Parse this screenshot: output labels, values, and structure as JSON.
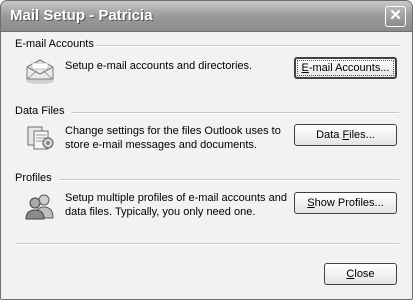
{
  "window": {
    "title": "Mail Setup - Patricia",
    "close_glyph": "✕"
  },
  "sections": [
    {
      "title": "E-mail Accounts",
      "description": "Setup e-mail accounts and directories.",
      "button": {
        "ul": "E",
        "rest": "-mail Accounts..."
      },
      "icon": "email-envelope-icon"
    },
    {
      "title": "Data Files",
      "description_lines": [
        "Change settings for the files Outlook uses to",
        "store e-mail messages and documents."
      ],
      "button": {
        "pre": "Data ",
        "ul": "F",
        "rest": "iles..."
      },
      "icon": "data-files-icon"
    },
    {
      "title": "Profiles",
      "description_lines": [
        "Setup multiple profiles of e-mail accounts and",
        "data files. Typically, you only need one."
      ],
      "button": {
        "ul": "S",
        "rest": "how Profiles..."
      },
      "icon": "profiles-icon"
    }
  ],
  "footer": {
    "close_button": {
      "ul": "C",
      "rest": "lose"
    }
  }
}
